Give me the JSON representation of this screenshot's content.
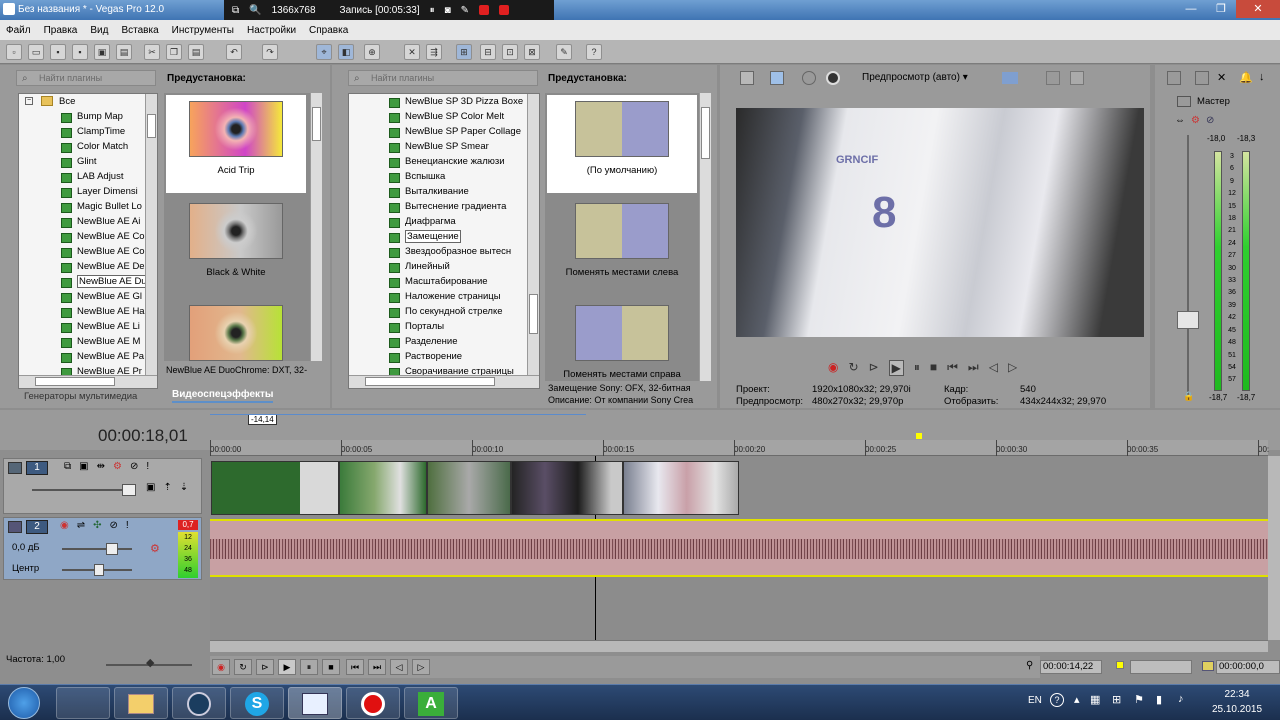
{
  "window": {
    "title": "Без названия * - Vegas Pro 12.0"
  },
  "recorder": {
    "resolution": "1366x768",
    "record_label": "Запись [00:05:33]"
  },
  "menu": [
    "Файл",
    "Правка",
    "Вид",
    "Вставка",
    "Инструменты",
    "Настройки",
    "Справка"
  ],
  "media_generators": {
    "search_placeholder": "Найти плагины",
    "root": "Все",
    "items": [
      "Bump Map",
      "ClampTime",
      "Color Match",
      "Glint",
      "LAB Adjust",
      "Layer Dimensi",
      "Magic Bullet Lo",
      "NewBlue AE Ai",
      "NewBlue AE Co",
      "NewBlue AE Co",
      "NewBlue AE De",
      "NewBlue AE Du",
      "NewBlue AE Gl",
      "NewBlue AE Ha",
      "NewBlue AE Li",
      "NewBlue AE M",
      "NewBlue AE Pa",
      "NewBlue AE Pr"
    ],
    "selected_index": 11,
    "preset_header": "Предустановка:",
    "presets": [
      "Acid Trip",
      "Black & White",
      ""
    ],
    "status": "NewBlue AE DuoChrome: DXT, 32-",
    "tab_generators": "Генераторы мультимедиа",
    "tab_fx": "Видеоспецэффекты"
  },
  "transitions": {
    "search_placeholder": "Найти плагины",
    "items": [
      "NewBlue SP 3D Pizza Boxe",
      "NewBlue SP Color Melt",
      "NewBlue SP Paper Collage",
      "NewBlue SP Smear",
      "Венецианские жалюзи",
      "Вспышка",
      "Выталкивание",
      "Вытеснение градиента",
      "Диафрагма",
      "Замещение",
      "Звездообразное вытесн",
      "Линейный",
      "Масштабирование",
      "Наложение страницы",
      "По секундной стрелке",
      "Порталы",
      "Разделение",
      "Растворение",
      "Сворачивание страницы",
      "Сжатие"
    ],
    "selected_index": 9,
    "preset_header": "Предустановка:",
    "presets": [
      "(По умолчанию)",
      "Поменять местами слева",
      "Поменять местами справа"
    ],
    "status_line1": "Замещение Sony: OFX, 32-битная",
    "status_line2": "Описание: От компании Sony Crea"
  },
  "preview": {
    "mode": "Предпросмотр (авто)",
    "project_label": "Проект:",
    "project_value": "1920x1080x32; 29,970i",
    "preview_label": "Предпросмотр:",
    "preview_value": "480x270x32; 29,970p",
    "frame_label": "Кадр:",
    "frame_value": "540",
    "display_label": "Отобразить:",
    "display_value": "434x244x32; 29,970",
    "jersey_number": "8",
    "jersey_name": "GRNCIF"
  },
  "mixer": {
    "title": "Мастер",
    "peak_left": "-18,0",
    "peak_right": "-18,3",
    "scale": [
      "3",
      "6",
      "9",
      "12",
      "15",
      "18",
      "21",
      "24",
      "27",
      "30",
      "33",
      "36",
      "39",
      "42",
      "45",
      "48",
      "51",
      "54",
      "57"
    ],
    "bottom_left": "-18,7",
    "bottom_right": "-18,7"
  },
  "timeline": {
    "timecode": "00:00:18,01",
    "marker": "-14,14",
    "ticks": [
      "00:00:00",
      "00:00:05",
      "00:00:10",
      "00:00:15",
      "00:00:20",
      "00:00:25",
      "00:00:30",
      "00:00:35",
      "00:"
    ],
    "video_track_number": "1",
    "audio_track_number": "2",
    "audio_level": "0,0 дБ",
    "audio_pan": "Центр",
    "meter_peak": "0,7",
    "meter_values": [
      "12",
      "24",
      "36",
      "48"
    ],
    "rate_label": "Частота: 1,00",
    "cursor_time": "00:00:14,22",
    "end_time": "00:00:00,0"
  },
  "taskbar": {
    "language": "EN",
    "time": "22:34",
    "date": "25.10.2015"
  }
}
